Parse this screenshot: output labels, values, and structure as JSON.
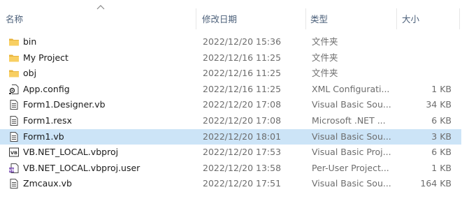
{
  "header": {
    "name_label": "名称",
    "date_label": "修改日期",
    "type_label": "类型",
    "size_label": "大小"
  },
  "files": [
    {
      "name": "bin",
      "date": "2022/12/20 15:36",
      "type": "文件夹",
      "size": "",
      "icon": "folder-icon"
    },
    {
      "name": "My Project",
      "date": "2022/12/16 11:25",
      "type": "文件夹",
      "size": "",
      "icon": "folder-icon"
    },
    {
      "name": "obj",
      "date": "2022/12/16 11:25",
      "type": "文件夹",
      "size": "",
      "icon": "folder-icon"
    },
    {
      "name": "App.config",
      "date": "2022/12/16 11:25",
      "type": "XML Configurati...",
      "size": "1 KB",
      "icon": "config-file-icon"
    },
    {
      "name": "Form1.Designer.vb",
      "date": "2022/12/20 17:08",
      "type": "Visual Basic Sou...",
      "size": "34 KB",
      "icon": "document-icon"
    },
    {
      "name": "Form1.resx",
      "date": "2022/12/20 17:08",
      "type": "Microsoft .NET ...",
      "size": "6 KB",
      "icon": "document-icon"
    },
    {
      "name": "Form1.vb",
      "date": "2022/12/20 18:01",
      "type": "Visual Basic Sou...",
      "size": "3 KB",
      "icon": "document-icon",
      "selected": true
    },
    {
      "name": "VB.NET_LOCAL.vbproj",
      "date": "2022/12/20 17:53",
      "type": "Visual Basic Proj...",
      "size": "6 KB",
      "icon": "vb-project-icon"
    },
    {
      "name": "VB.NET_LOCAL.vbproj.user",
      "date": "2022/12/20 13:58",
      "type": "Per-User Project...",
      "size": "1 KB",
      "icon": "user-project-icon"
    },
    {
      "name": "Zmcaux.vb",
      "date": "2022/12/20 17:51",
      "type": "Visual Basic Sou...",
      "size": "164 KB",
      "icon": "document-icon"
    }
  ]
}
